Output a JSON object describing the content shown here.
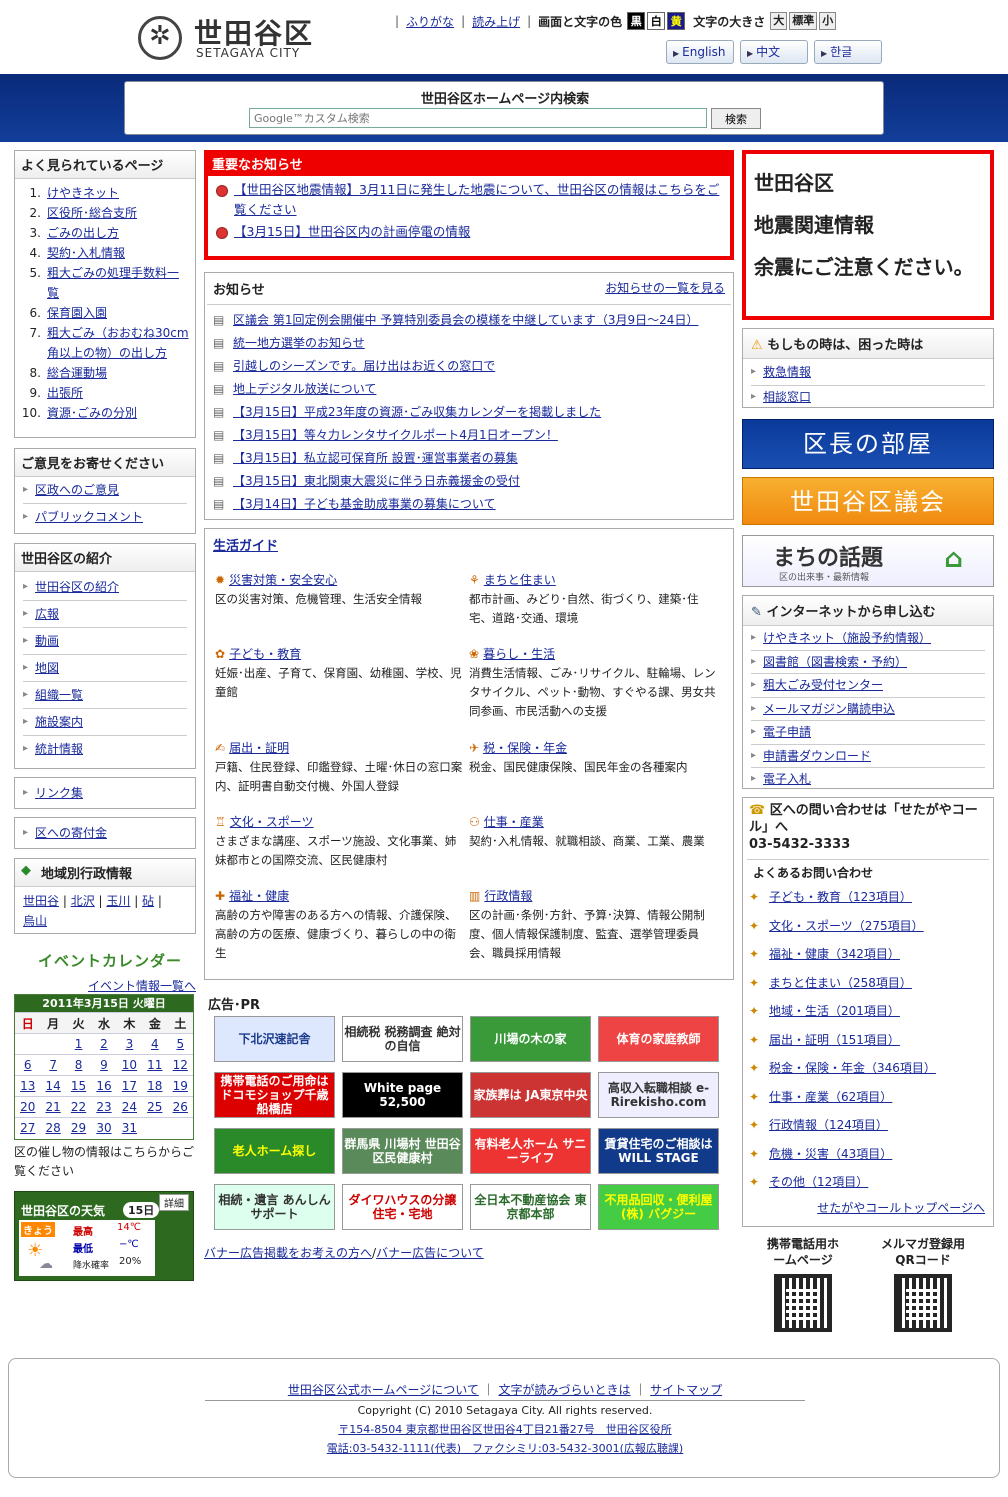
{
  "header": {
    "logo_jp": "世田谷区",
    "logo_en": "SETAGAYA CITY",
    "furigana": "ふりがな",
    "yomiage": "読み上げ",
    "color_label": "画面と文字の色",
    "color_black": "黒",
    "color_white": "白",
    "color_yellow": "黄",
    "size_label": "文字の大きさ",
    "size_large": "大",
    "size_std": "標準",
    "size_small": "小",
    "langs": [
      "English",
      "中文",
      "한글"
    ]
  },
  "search": {
    "title": "世田谷区ホームページ内検索",
    "placeholder": "Google™カスタム検索",
    "button": "検索"
  },
  "popular": {
    "title": "よく見られているページ",
    "items": [
      {
        "n": "1.",
        "t": "けやきネット"
      },
      {
        "n": "2.",
        "t": "区役所･総合支所"
      },
      {
        "n": "3.",
        "t": "ごみの出し方"
      },
      {
        "n": "4.",
        "t": "契約･入札情報"
      },
      {
        "n": "5.",
        "t": "粗大ごみの処理手数料一覧"
      },
      {
        "n": "6.",
        "t": "保育園入園"
      },
      {
        "n": "7.",
        "t": "粗大ごみ（おおむね30cm角以上の物）の出し方"
      },
      {
        "n": "8.",
        "t": "総合運動場"
      },
      {
        "n": "9.",
        "t": "出張所"
      },
      {
        "n": "10.",
        "t": "資源･ごみの分別"
      }
    ]
  },
  "opinion": {
    "title": "ご意見をお寄せください",
    "items": [
      "区政へのご意見",
      "パブリックコメント"
    ]
  },
  "intro": {
    "title": "世田谷区の紹介",
    "items": [
      "世田谷区の紹介",
      "広報",
      "動画",
      "地図",
      "組織一覧",
      "施設案内",
      "統計情報"
    ]
  },
  "links": {
    "link": "リンク集",
    "donate": "区への寄付金"
  },
  "region": {
    "title": "地域別行政情報",
    "items": [
      "世田谷",
      "北沢",
      "玉川",
      "砧",
      "烏山"
    ]
  },
  "event": {
    "title": "イベントカレンダー",
    "list_link": "イベント情報一覧へ",
    "month": "2011年3月15日 火曜日",
    "dow": [
      "日",
      "月",
      "火",
      "水",
      "木",
      "金",
      "土"
    ],
    "weeks": [
      [
        "",
        "",
        "1",
        "2",
        "3",
        "4",
        "5"
      ],
      [
        "6",
        "7",
        "8",
        "9",
        "10",
        "11",
        "12"
      ],
      [
        "13",
        "14",
        "15",
        "16",
        "17",
        "18",
        "19"
      ],
      [
        "20",
        "21",
        "22",
        "23",
        "24",
        "25",
        "26"
      ],
      [
        "27",
        "28",
        "29",
        "30",
        "31",
        "",
        ""
      ]
    ],
    "note": "区の催し物の情報はこちらからご覧ください"
  },
  "weather": {
    "title": "世田谷区の天気",
    "date": "15日",
    "detail": "詳細",
    "today": "きょう",
    "max_label": "最高",
    "max": "14℃",
    "min_label": "最低",
    "min": "−℃",
    "rain_label": "降水確率",
    "rain": "20%"
  },
  "important": {
    "title": "重要なお知らせ",
    "items": [
      "【世田谷区地震情報】3月11日に発生した地震について、世田谷区の情報はこちらをご覧ください",
      "【3月15日】世田谷区内の計画停電の情報"
    ]
  },
  "news": {
    "title": "お知らせ",
    "more": "お知らせの一覧を見る",
    "items": [
      "区議会 第1回定例会開催中 予算特別委員会の模様を中継しています（3月9日～24日）",
      "統一地方選挙のお知らせ",
      "引越しのシーズンです。届け出はお近くの窓口で",
      "地上デジタル放送について",
      "【3月15日】平成23年度の資源･ごみ収集カレンダーを掲載しました",
      "【3月15日】等々力レンタサイクルポート4月1日オープン！",
      "【3月15日】私立認可保育所 設置･運営事業者の募集",
      "【3月15日】東北関東大震災に伴う日赤義援金の受付",
      "【3月14日】子ども基金助成事業の募集について"
    ]
  },
  "guide": {
    "title": "生活ガイド",
    "items": [
      {
        "h": "災害対策・安全安心",
        "d": "区の災害対策、危機管理、生活安全情報"
      },
      {
        "h": "まちと住まい",
        "d": "都市計画、みどり･自然、街づくり、建築･住宅、道路･交通、環境"
      },
      {
        "h": "子ども・教育",
        "d": "妊娠･出産、子育て、保育園、幼稚園、学校、児童館"
      },
      {
        "h": "暮らし・生活",
        "d": "消費生活情報、ごみ･リサイクル、駐輪場、レンタサイクル、ペット･動物、すぐやる課、男女共同参画、市民活動への支援"
      },
      {
        "h": "届出・証明",
        "d": "戸籍、住民登録、印鑑登録、土曜･休日の窓口案内、証明書自動交付機、外国人登録"
      },
      {
        "h": "税・保険・年金",
        "d": "税金、国民健康保険、国民年金の各種案内"
      },
      {
        "h": "文化・スポーツ",
        "d": "さまざまな講座、スポーツ施設、文化事業、姉妹都市との国際交流、区民健康村"
      },
      {
        "h": "仕事・産業",
        "d": "契約･入札情報、就職相談、商業、工業、農業"
      },
      {
        "h": "福祉・健康",
        "d": "高齢の方や障害のある方への情報、介護保険、高齢の方の医療、健康づくり、暮らしの中の衛生"
      },
      {
        "h": "行政情報",
        "d": "区の計画･条例･方針、予算･決算、情報公開制度、個人情報保護制度、監査、選挙管理委員会、職員採用情報"
      }
    ]
  },
  "ads": {
    "title": "広告･PR",
    "items": [
      "下北沢速記舎",
      "相続税 税務調査 絶対の自信",
      "川場の木の家",
      "体育の家庭教師",
      "携帯電話のご用命はドコモショップ千歳船橋店",
      "White page 52,500",
      "家族葬は JA東京中央",
      "高収入転職相談 e-Rirekisho.com",
      "老人ホーム探し",
      "群馬県 川場村 世田谷区民健康村",
      "有料老人ホーム サニーライフ",
      "賃貸住宅のご相談は WILL STAGE",
      "相続・遺言 あんしんサポート",
      "ダイワハウスの分譲住宅・宅地",
      "全日本不動産協会 東京都本部",
      "不用品回収・便利屋 (株) バグジー"
    ],
    "link1": "バナー広告掲載をお考えの方へ",
    "link2": "バナー広告について"
  },
  "quake": {
    "l1": "世田谷区",
    "l2": "地震関連情報",
    "l3": "余震にご注意ください。"
  },
  "emergency": {
    "title": "もしもの時は、困った時は",
    "items": [
      "救急情報",
      "相談窓口"
    ]
  },
  "mayor": "区長の部屋",
  "council": "世田谷区議会",
  "topics": {
    "t": "まちの話題",
    "sub": "区の出来事・最新情報"
  },
  "online": {
    "title": "インターネットから申し込む",
    "items": [
      "けやきネット（施設予約情報）",
      "図書館（図書検索・予約）",
      "粗大ごみ受付センター",
      "メールマガジン購読申込",
      "電子申請",
      "申請書ダウンロード",
      "電子入札"
    ]
  },
  "call": {
    "title": "区への問い合わせは「せたがやコール」へ",
    "tel": "03-5432-3333",
    "faq": "よくあるお問い合わせ",
    "items": [
      "子ども・教育（123項目）",
      "文化・スポーツ（275項目）",
      "福祉・健康（342項目）",
      "まちと住まい（258項目）",
      "地域・生活（201項目）",
      "届出・証明（151項目）",
      "税金・保険・年金（346項目）",
      "仕事・産業（62項目）",
      "行政情報（124項目）",
      "危機・災害（43項目）",
      "その他（12項目）"
    ],
    "top": "せたがやコールトップページへ"
  },
  "qr": {
    "mobile": "携帯電話用ホームページ",
    "mail": "メルマガ登録用QRコード"
  },
  "footer": {
    "l1": "世田谷区公式ホームページについて",
    "l2": "文字が読みづらいときは",
    "l3": "サイトマップ",
    "copy": "Copyright (C) 2010 Setagaya City. All rights reserved.",
    "addr": "〒154-8504 東京都世田谷区世田谷4丁目21番27号　世田谷区役所",
    "tel": "電話:03-5432-1111(代表)　ファクシミリ:03-5432-3001(広報広聴課)"
  }
}
